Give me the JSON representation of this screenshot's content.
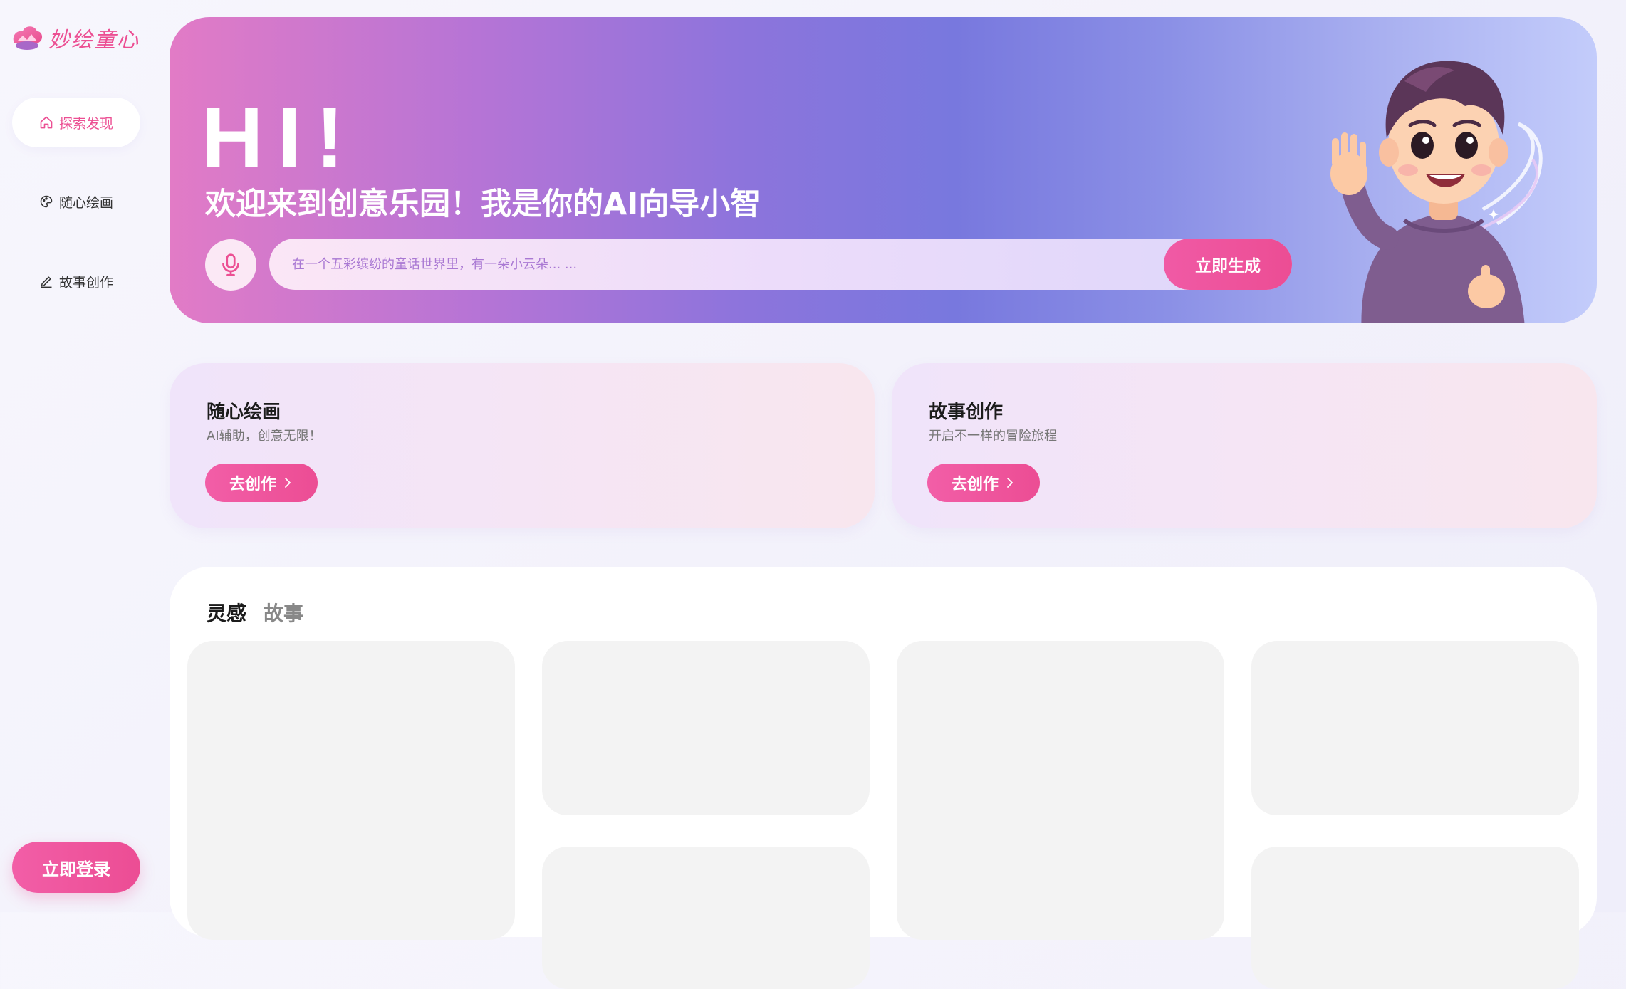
{
  "app": {
    "logo_text": "妙绘童心"
  },
  "sidebar": {
    "items": [
      {
        "label": "探索发现",
        "icon": "home-icon",
        "active": true
      },
      {
        "label": "随心绘画",
        "icon": "palette-icon",
        "active": false
      },
      {
        "label": "故事创作",
        "icon": "pen-icon",
        "active": false
      }
    ],
    "login_label": "立即登录"
  },
  "hero": {
    "greeting": "HI!",
    "welcome": "欢迎来到创意乐园！我是你的AI向导小智",
    "search_placeholder": "在一个五彩缤纷的童话世界里，有一朵小云朵... ...",
    "generate_label": "立即生成"
  },
  "features": [
    {
      "title": "随心绘画",
      "subtitle": "AI辅助，创意无限！",
      "button": "去创作"
    },
    {
      "title": "故事创作",
      "subtitle": "开启不一样的冒险旅程",
      "button": "去创作"
    }
  ],
  "gallery": {
    "tabs": [
      {
        "label": "灵感",
        "active": true
      },
      {
        "label": "故事",
        "active": false
      }
    ]
  },
  "colors": {
    "accent": "#ec4f93",
    "hero_gradient": [
      "#e27bc6",
      "#7878de",
      "#c3ccfb"
    ],
    "placeholder_tile": "#f3f3f3"
  }
}
